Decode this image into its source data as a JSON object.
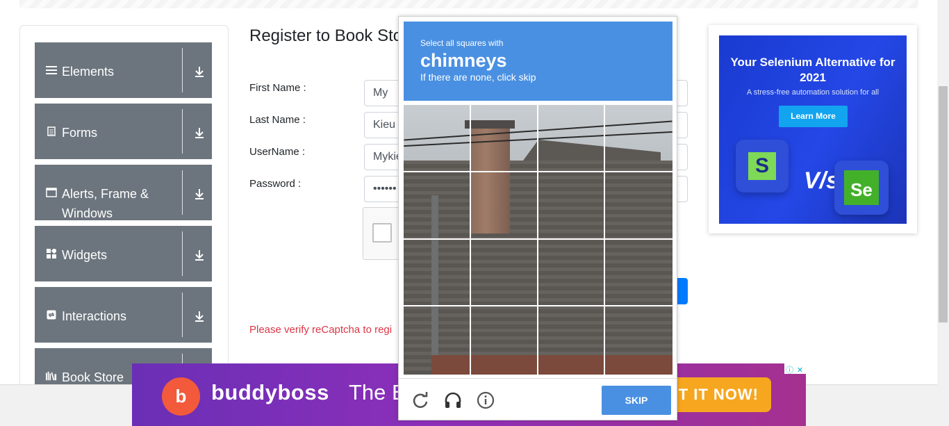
{
  "sidebar": {
    "groups": [
      {
        "label": "Elements",
        "icon": "list-icon"
      },
      {
        "label": "Forms",
        "icon": "document-icon"
      },
      {
        "label": "Alerts, Frame & Windows",
        "icon": "window-icon"
      },
      {
        "label": "Widgets",
        "icon": "widgets-icon"
      },
      {
        "label": "Interactions",
        "icon": "interactions-icon"
      },
      {
        "label": "Book Store",
        "icon": "books-icon"
      }
    ]
  },
  "form": {
    "title": "Register to Book Sto",
    "first_name_label": "First Name :",
    "first_name_value": "My",
    "last_name_label": "Last Name :",
    "last_name_value": "Kieu",
    "username_label": "UserName :",
    "username_value": "Mykie",
    "password_label": "Password :",
    "password_value": "••••••",
    "error_text": "Please verify reCaptcha to regi"
  },
  "captcha": {
    "instruction": "Select all squares with",
    "target": "chimneys",
    "hint": "If there are none, click skip",
    "skip_label": "SKIP",
    "icons": [
      "reload-icon",
      "headphones-icon",
      "info-icon"
    ]
  },
  "side_ad": {
    "title": "Your Selenium Alternative for 2021",
    "subtitle": "A stress-free automation solution for all",
    "button": "Learn More",
    "left_logo": "S",
    "vs": "V/s",
    "right_logo": "Se"
  },
  "banner": {
    "logo_glyph": "b",
    "brand": "buddyboss",
    "tagline": "The B",
    "cta": "T IT NOW!",
    "colors": {
      "left": "#6a2fb6",
      "right": "#a5308f",
      "cta": "#f6a71f",
      "logo": "#f25a3b"
    }
  },
  "colors": {
    "sidebar_group": "#6c757d",
    "captcha_blue": "#4a90e2",
    "error": "#dc3545",
    "primary": "#007bff"
  }
}
